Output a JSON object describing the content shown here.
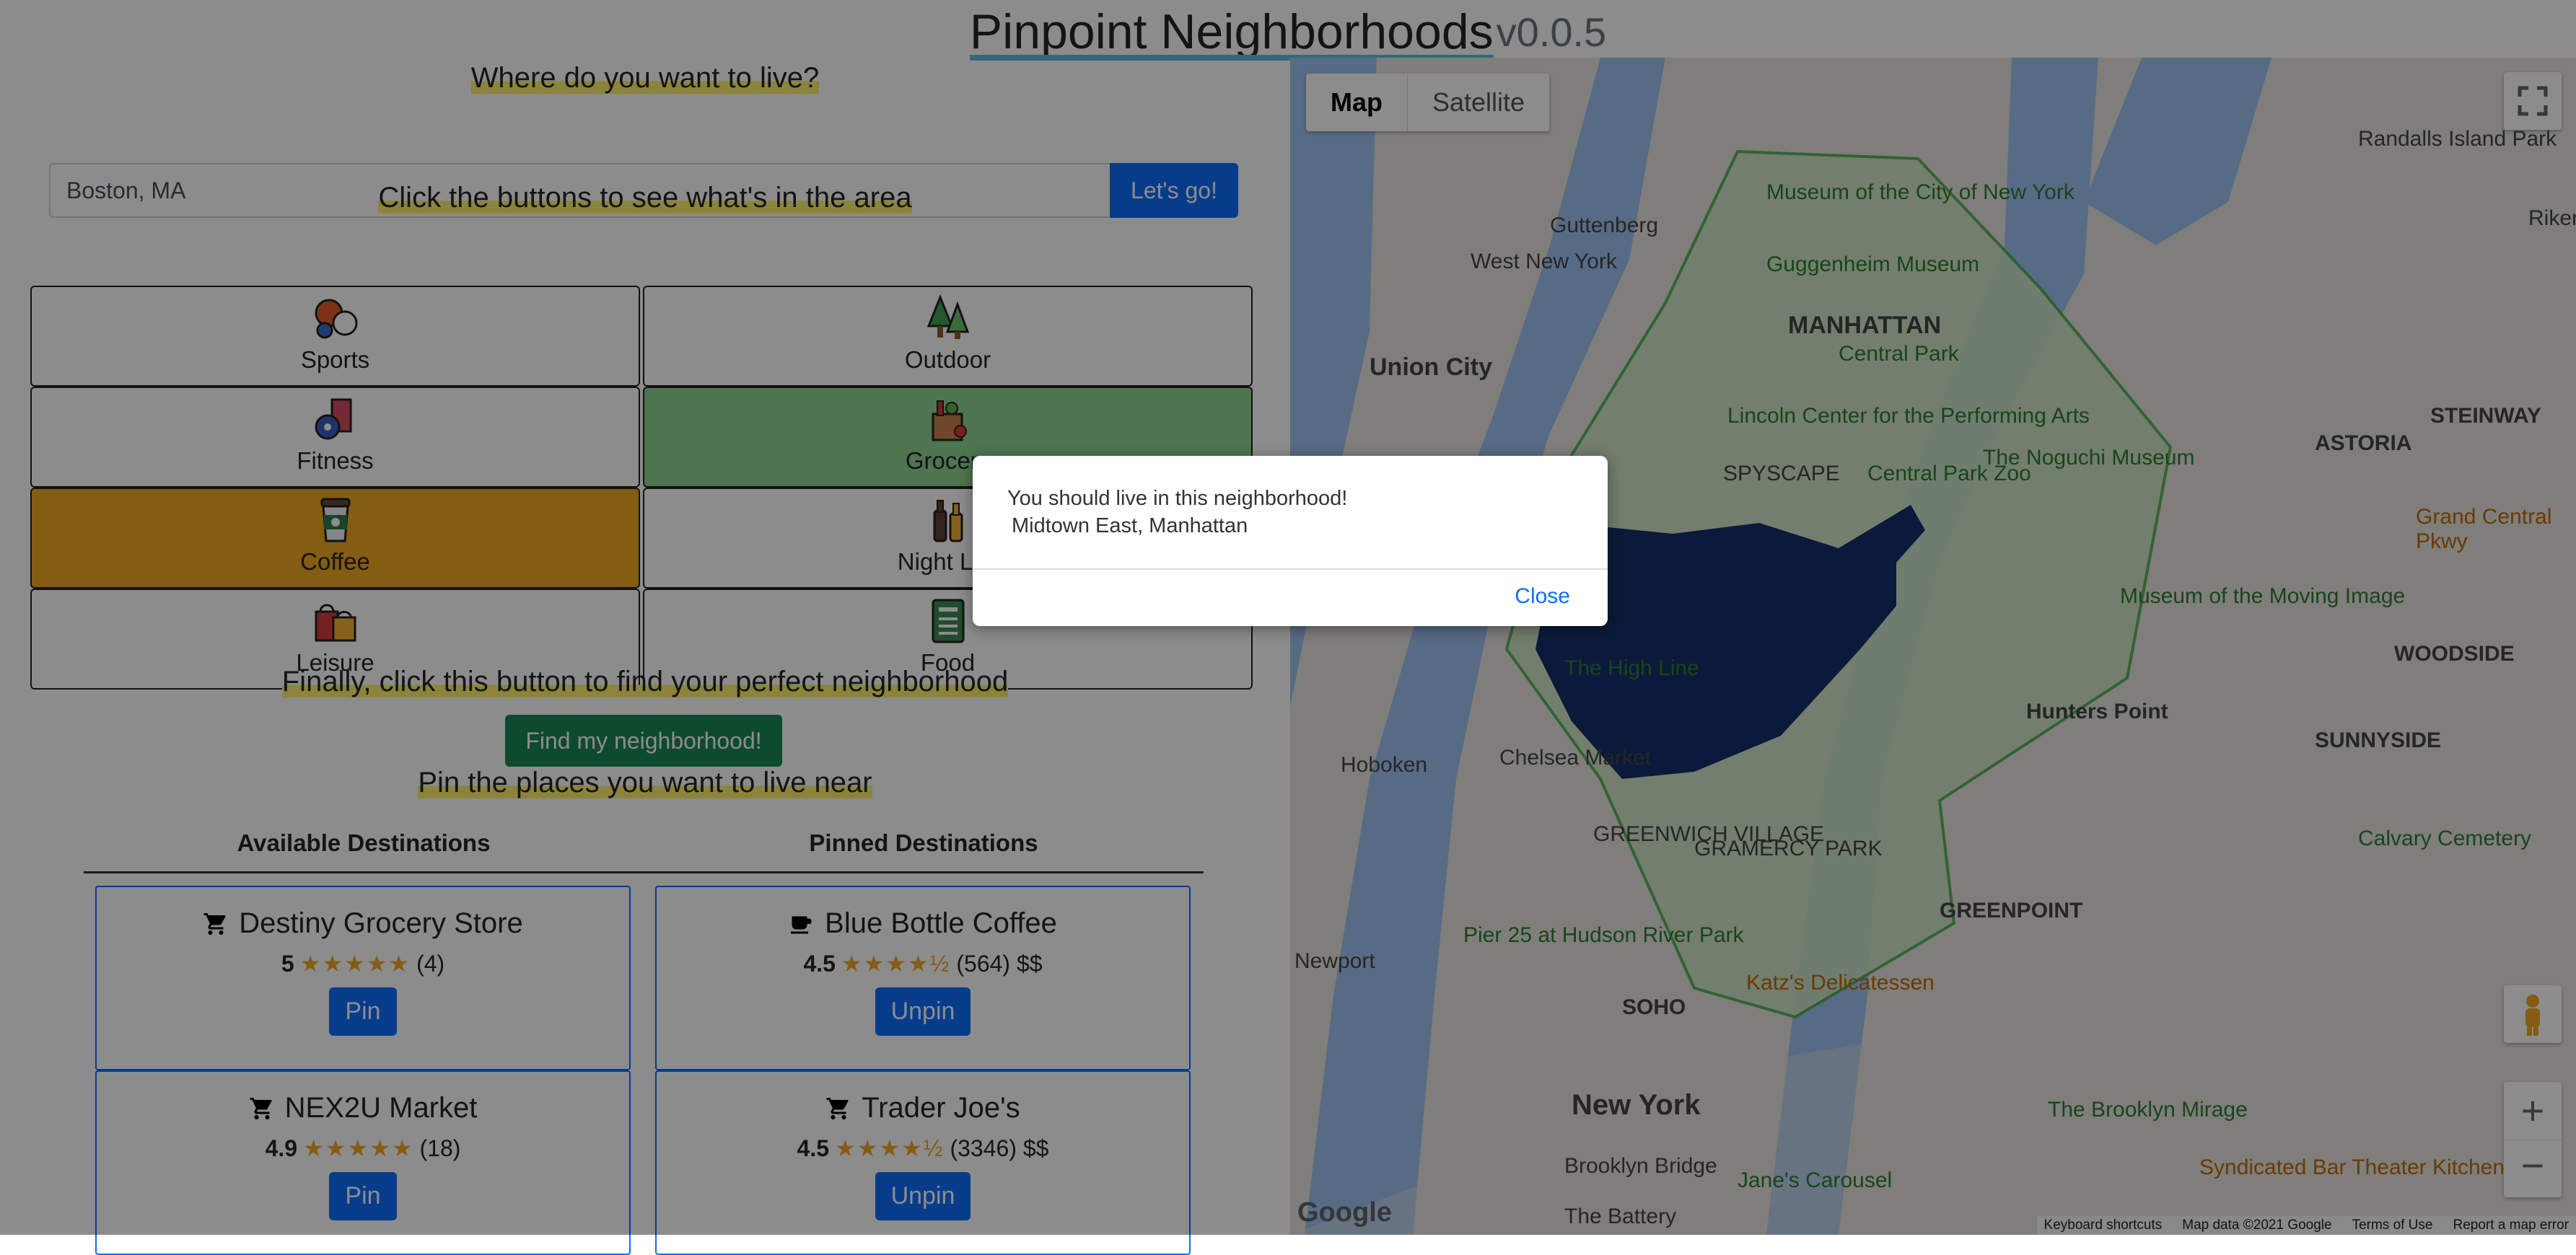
{
  "header": {
    "title": "Pinpoint Neighborhoods",
    "version": "v0.0.5"
  },
  "search": {
    "heading": "Where do you want to live?",
    "value": "Boston, MA",
    "button": "Let's go!"
  },
  "categories": {
    "heading": "Click the buttons to see what's in the area",
    "items": [
      {
        "label": "Sports",
        "icon": "sports-balls-icon"
      },
      {
        "label": "Outdoor",
        "icon": "trees-icon"
      },
      {
        "label": "Fitness",
        "icon": "weights-icon"
      },
      {
        "label": "Grocery",
        "icon": "grocery-bag-icon",
        "selected": true,
        "color": "#8fd693"
      },
      {
        "label": "Coffee",
        "icon": "coffee-cup-icon",
        "selected": true,
        "color": "#f0a821"
      },
      {
        "label": "Night Life",
        "icon": "bottles-icon"
      },
      {
        "label": "Leisure",
        "icon": "shopping-bags-icon"
      },
      {
        "label": "Food",
        "icon": "menu-icon"
      }
    ]
  },
  "find": {
    "heading": "Finally, click this button to find your perfect neighborhood",
    "button": "Find my neighborhood!"
  },
  "pins": {
    "heading": "Pin the places you want to live near",
    "available_heading": "Available Destinations",
    "pinned_heading": "Pinned Destinations",
    "available": [
      {
        "name": "Destiny Grocery Store",
        "rating": "5",
        "count": "(4)",
        "price": "",
        "button": "Pin",
        "stars": 5
      },
      {
        "name": "NEX2U Market",
        "rating": "4.9",
        "count": "(18)",
        "price": "",
        "button": "Pin",
        "stars": 5
      }
    ],
    "pinned": [
      {
        "name": "Blue Bottle Coffee",
        "rating": "4.5",
        "count": "(564)",
        "price": "$$",
        "button": "Unpin",
        "stars": 4.5
      },
      {
        "name": "Trader Joe's",
        "rating": "4.5",
        "count": "(3346)",
        "price": "$$",
        "button": "Unpin",
        "stars": 4.5
      }
    ]
  },
  "map": {
    "type_map": "Map",
    "type_satellite": "Satellite",
    "labels": [
      "MANHATTAN",
      "Central Park",
      "Union City",
      "ASTORIA",
      "STEINWAY",
      "Randalls Island Park",
      "Hoboken",
      "Chelsea Market",
      "GREENPOINT",
      "New York",
      "SOHO",
      "Katz's Delicatessen",
      "The Brooklyn Mirage",
      "Calvary Cemetery",
      "WOODSIDE",
      "SUNNYSIDE",
      "Lincoln Center for the Performing Arts",
      "Guggenheim Museum",
      "Museum of the City of New York",
      "The Noguchi Museum",
      "Central Park Zoo",
      "Museum of the Moving Image",
      "SPYSCAPE",
      "The High Line",
      "Pier 25 at Hudson River Park",
      "Brooklyn Bridge",
      "Jane's Carousel",
      "The Battery",
      "Syndicated Bar Theater Kitchen",
      "West New York",
      "Guttenberg",
      "Rikers",
      "Grand Central Pkwy",
      "GREENWICH VILLAGE",
      "GRAMERCY PARK",
      "Newport",
      "Hunters Point"
    ],
    "footer": {
      "shortcuts": "Keyboard shortcuts",
      "data": "Map data ©2021 Google",
      "terms": "Terms of Use",
      "report": "Report a map error"
    },
    "brand": "Google",
    "colors": {
      "polygon": "#14316a",
      "outline": "#4caf50",
      "water": "#9fc4f2"
    }
  },
  "modal": {
    "message": "You should live in this neighborhood!",
    "neighborhood": "Midtown East, Manhattan",
    "close": "Close"
  }
}
